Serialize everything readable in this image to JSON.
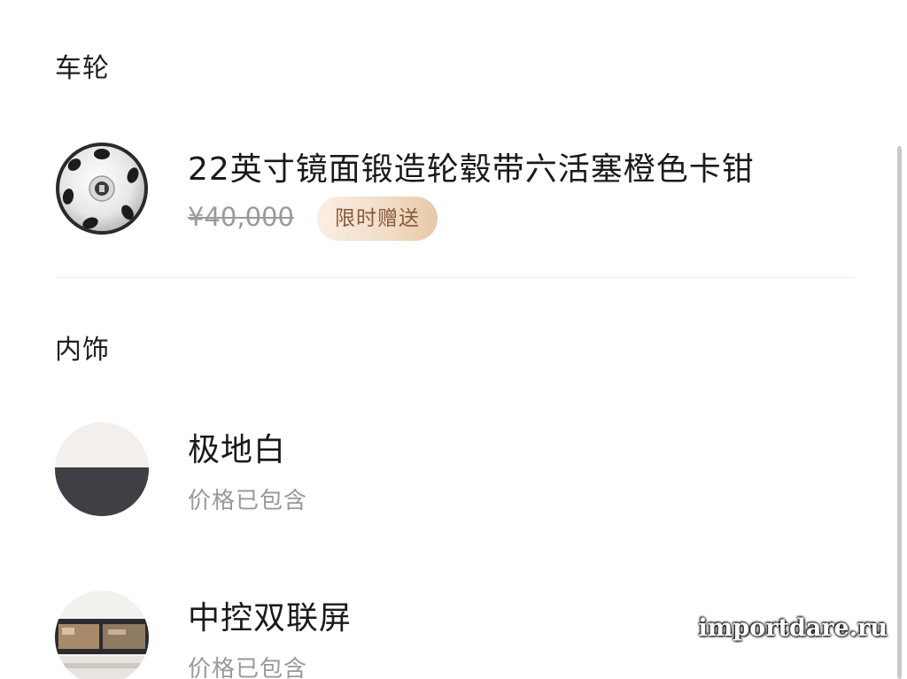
{
  "sections": {
    "wheels": {
      "title": "车轮",
      "item": {
        "thumb_icon": "wheel-rim-icon",
        "name": "22英寸镜面锻造轮毂带六活塞橙色卡钳",
        "old_price": "¥40,000",
        "badge": "限时赠送"
      }
    },
    "interior": {
      "title": "内饰",
      "items": [
        {
          "thumb_icon": "color-swatch-icon",
          "name": "极地白",
          "note": "价格已包含",
          "swatch_colors": [
            "#f2efec",
            "#3e4046"
          ]
        },
        {
          "thumb_icon": "dashboard-screen-icon",
          "name": "中控双联屏",
          "note": "价格已包含"
        }
      ]
    }
  },
  "watermark": "importdare.ru",
  "colors": {
    "badge_text": "#8a5a3a",
    "badge_bg_start": "#fbeee2",
    "badge_bg_end": "#e8c9a8",
    "muted_text": "#999999"
  }
}
